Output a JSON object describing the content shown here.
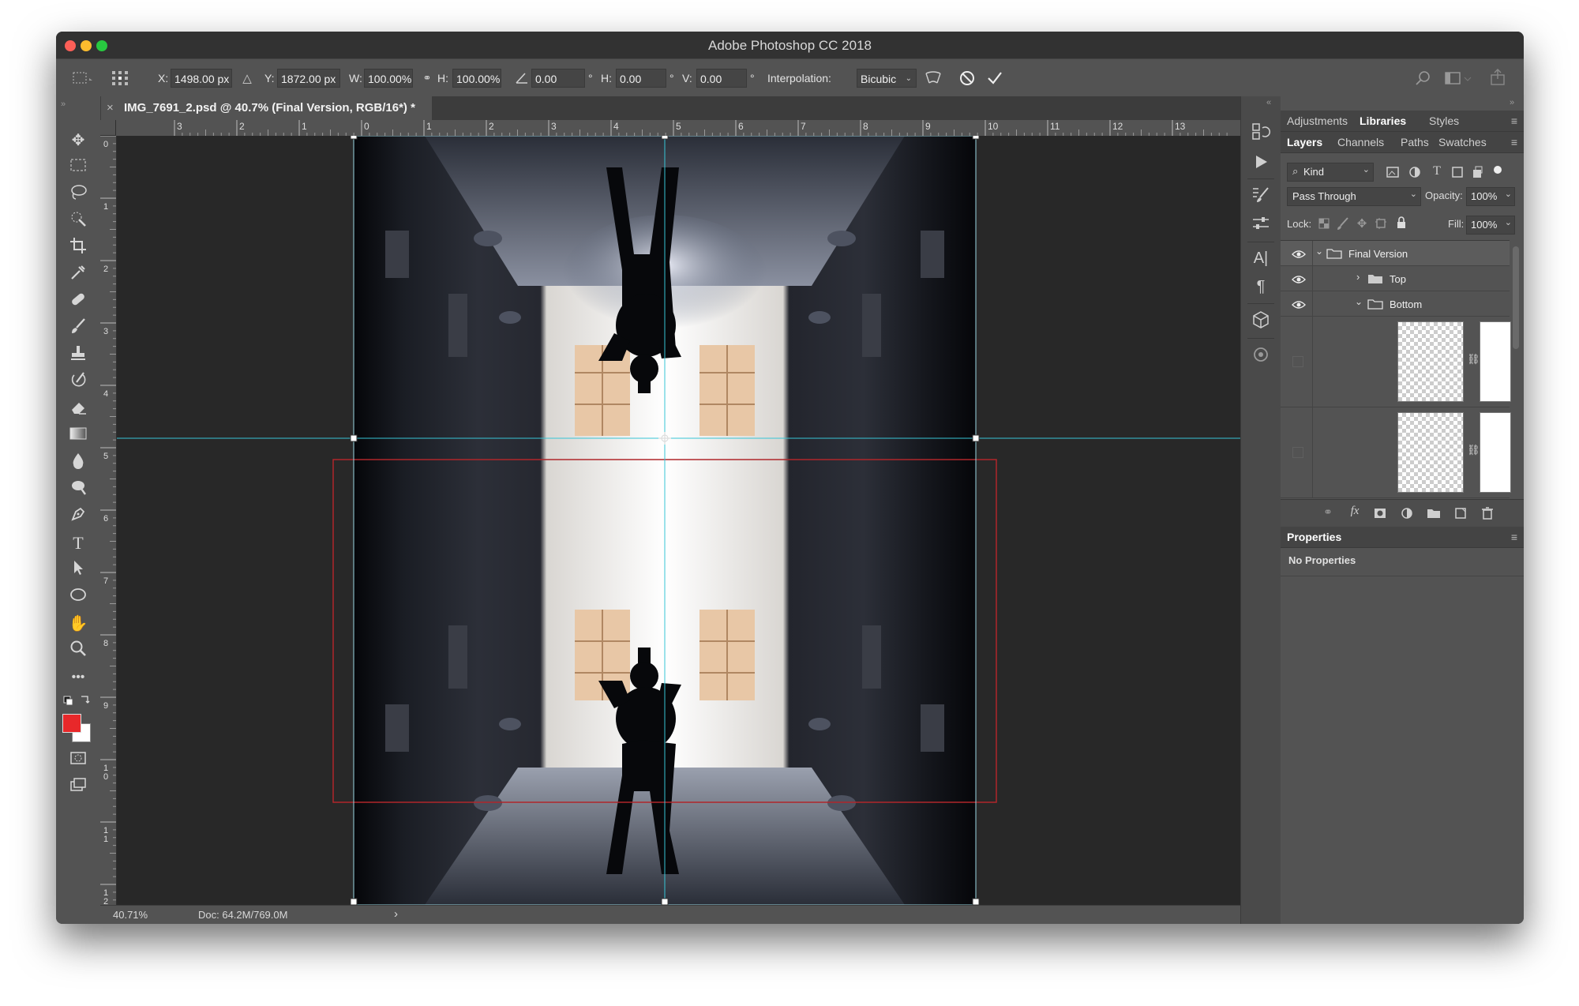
{
  "window": {
    "title": "Adobe Photoshop CC 2018"
  },
  "options": {
    "x_label": "X:",
    "x_value": "1498.00 px",
    "y_label": "Y:",
    "y_value": "1872.00 px",
    "w_label": "W:",
    "w_value": "100.00%",
    "h_label": "H:",
    "h_value": "100.00%",
    "angle_value": "0.00",
    "angle_unit": "°",
    "hskew_label": "H:",
    "hskew_value": "0.00",
    "hskew_unit": "°",
    "vskew_label": "V:",
    "vskew_value": "0.00",
    "vskew_unit": "°",
    "interp_label": "Interpolation:",
    "interp_value": "Bicubic"
  },
  "document": {
    "tab_title": "IMG_7691_2.psd @ 40.7% (Final Version, RGB/16*) *",
    "close_symbol": "×"
  },
  "ruler": {
    "h_ticks": [
      "3",
      "2",
      "1",
      "0",
      "1",
      "2",
      "3",
      "4",
      "5",
      "6",
      "7",
      "8",
      "9",
      "10",
      "11",
      "12",
      "13"
    ],
    "v_ticks": [
      "0",
      "1",
      "2",
      "3",
      "4",
      "5",
      "6",
      "7",
      "8",
      "9",
      "10",
      "11",
      "12"
    ]
  },
  "status": {
    "zoom": "40.71%",
    "doc": "Doc: 64.2M/769.0M",
    "arrow": "›"
  },
  "panels": {
    "top_tabs": [
      "Adjustments",
      "Libraries",
      "Styles"
    ],
    "layer_tabs": [
      "Layers",
      "Channels",
      "Paths",
      "Swatches"
    ],
    "kind": "Kind",
    "blend_mode": "Pass Through",
    "opacity_label": "Opacity:",
    "opacity_value": "100%",
    "lock_label": "Lock:",
    "fill_label": "Fill:",
    "fill_value": "100%",
    "layers": [
      {
        "name": "Final Version",
        "expanded": true,
        "visible": true
      },
      {
        "name": "Top",
        "expanded": false,
        "visible": true
      },
      {
        "name": "Bottom",
        "expanded": true,
        "visible": true
      }
    ],
    "properties_title": "Properties",
    "properties_text": "No Properties"
  },
  "colors": {
    "foreground": "#e8282a",
    "background": "#ffffff",
    "guide": "#37c5d6"
  },
  "icons": [
    "move-icon",
    "marquee-icon",
    "lasso-icon",
    "quick-select-icon",
    "crop-icon",
    "eyedropper-icon",
    "healing-icon",
    "brush-icon",
    "stamp-icon",
    "history-brush-icon",
    "eraser-icon",
    "gradient-icon",
    "blur-icon",
    "dodge-icon",
    "pen-icon",
    "type-icon",
    "path-select-icon",
    "ellipse-icon",
    "hand-icon",
    "zoom-icon",
    "more-icon"
  ]
}
